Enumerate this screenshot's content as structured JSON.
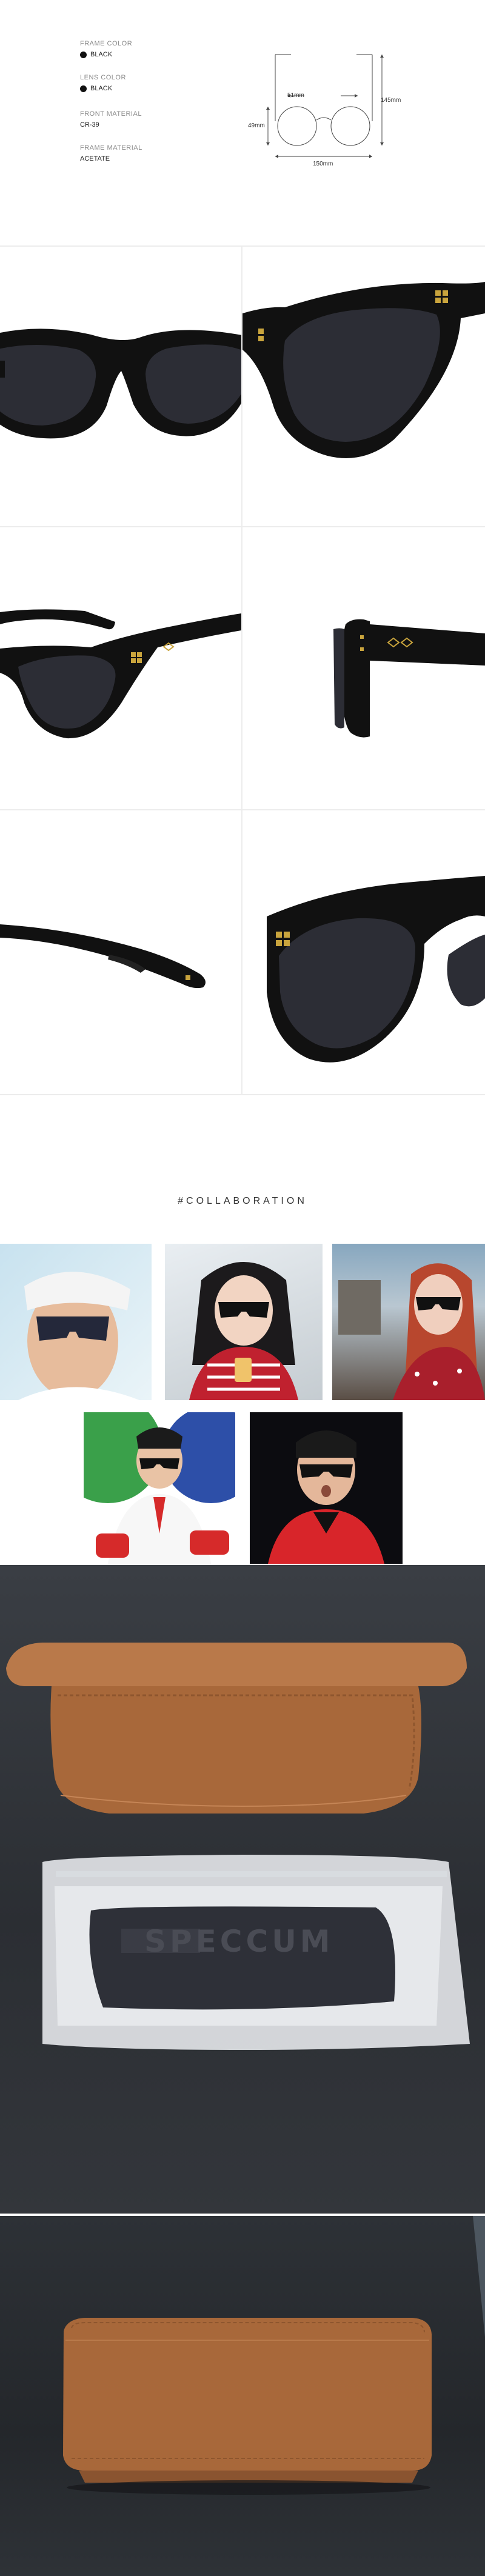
{
  "specs": {
    "frame_color_label": "FRAME COLOR",
    "frame_color_value": "BLACK",
    "lens_color_label": "LENS COLOR",
    "lens_color_value": "BLACK",
    "front_material_label": "FRONT MATERIAL",
    "front_material_value": "CR-39",
    "frame_material_label": "FRAME MATERIAL",
    "frame_material_value": "ACETATE"
  },
  "dimensions": {
    "bridge": "51mm",
    "lens_height": "49mm",
    "total_width": "150mm",
    "temple_length": "145mm"
  },
  "collaboration": {
    "title": "#COLLABORATION"
  },
  "pouch": {
    "brand_text": "SPECCUM"
  },
  "colors": {
    "frame": "#111111",
    "lens": "#2c2d35",
    "stud": "#c9a43d",
    "case_leather": "#a8683a",
    "background": "#ffffff"
  }
}
